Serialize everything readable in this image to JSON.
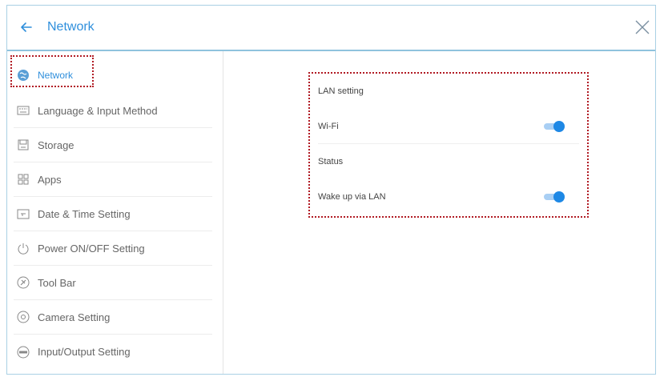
{
  "header": {
    "title": "Network",
    "back_icon": "arrow-left-icon",
    "close_icon": "close-icon",
    "accent_color": "#2f8fdc"
  },
  "sidebar": {
    "items": [
      {
        "label": "Network",
        "icon": "globe-icon",
        "active": true
      },
      {
        "label": "Language & Input Method",
        "icon": "keyboard-icon"
      },
      {
        "label": "Storage",
        "icon": "storage-icon"
      },
      {
        "label": "Apps",
        "icon": "apps-grid-icon"
      },
      {
        "label": "Date & Time Setting",
        "icon": "calendar-icon"
      },
      {
        "label": "Power ON/OFF Setting",
        "icon": "power-icon"
      },
      {
        "label": "Tool Bar",
        "icon": "toolbar-icon"
      },
      {
        "label": "Camera Setting",
        "icon": "camera-icon"
      },
      {
        "label": "Input/Output Setting",
        "icon": "input-output-icon"
      }
    ]
  },
  "lan_panel": {
    "heading": "LAN setting",
    "rows": [
      {
        "label": "Wi-Fi",
        "toggle": true
      },
      {
        "label": "Status"
      },
      {
        "label": "Wake up via LAN",
        "toggle": true
      }
    ]
  },
  "colors": {
    "highlight_border": "#b11b24",
    "toggle_on": "#1e88e5"
  }
}
